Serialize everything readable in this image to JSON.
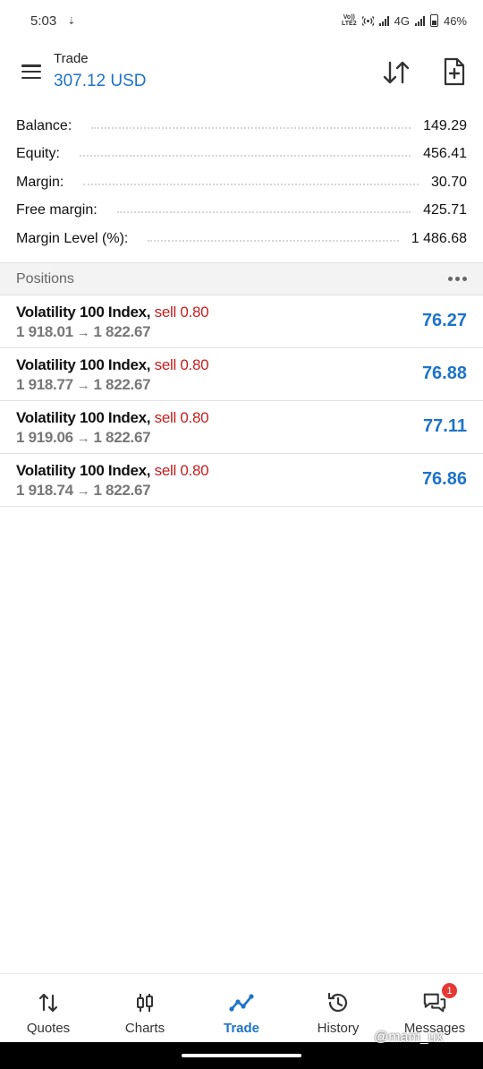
{
  "status_bar": {
    "time": "5:03",
    "download_indicator": "⇣",
    "volte_label": "Vo)) LTE2",
    "network": "4G",
    "battery": "46%"
  },
  "header": {
    "title": "Trade",
    "subtitle": "307.12 USD"
  },
  "summary": [
    {
      "label": "Balance:",
      "value": "149.29"
    },
    {
      "label": "Equity:",
      "value": "456.41"
    },
    {
      "label": "Margin:",
      "value": "30.70"
    },
    {
      "label": "Free margin:",
      "value": "425.71"
    },
    {
      "label": "Margin Level (%):",
      "value": "1 486.68"
    }
  ],
  "positions": {
    "title": "Positions",
    "items": [
      {
        "symbol": "Volatility 100 Index,",
        "side": "sell 0.80",
        "open": "1 918.01",
        "arrow": "→",
        "current": "1 822.67",
        "profit": "76.27"
      },
      {
        "symbol": "Volatility 100 Index,",
        "side": "sell 0.80",
        "open": "1 918.77",
        "arrow": "→",
        "current": "1 822.67",
        "profit": "76.88"
      },
      {
        "symbol": "Volatility 100 Index,",
        "side": "sell 0.80",
        "open": "1 919.06",
        "arrow": "→",
        "current": "1 822.67",
        "profit": "77.11"
      },
      {
        "symbol": "Volatility 100 Index,",
        "side": "sell 0.80",
        "open": "1 918.74",
        "arrow": "→",
        "current": "1 822.67",
        "profit": "76.86"
      }
    ]
  },
  "bottom_nav": {
    "items": [
      {
        "label": "Quotes",
        "icon": "quotes-arrows-icon"
      },
      {
        "label": "Charts",
        "icon": "candlestick-icon"
      },
      {
        "label": "Trade",
        "icon": "trend-line-icon",
        "active": true
      },
      {
        "label": "History",
        "icon": "history-clock-icon"
      },
      {
        "label": "Messages",
        "icon": "chat-bubbles-icon",
        "badge": "1"
      }
    ]
  },
  "watermark": "@mam_ux",
  "colors": {
    "accent": "#1e73c8",
    "sell": "#c41e1e",
    "badge": "#e53935"
  }
}
